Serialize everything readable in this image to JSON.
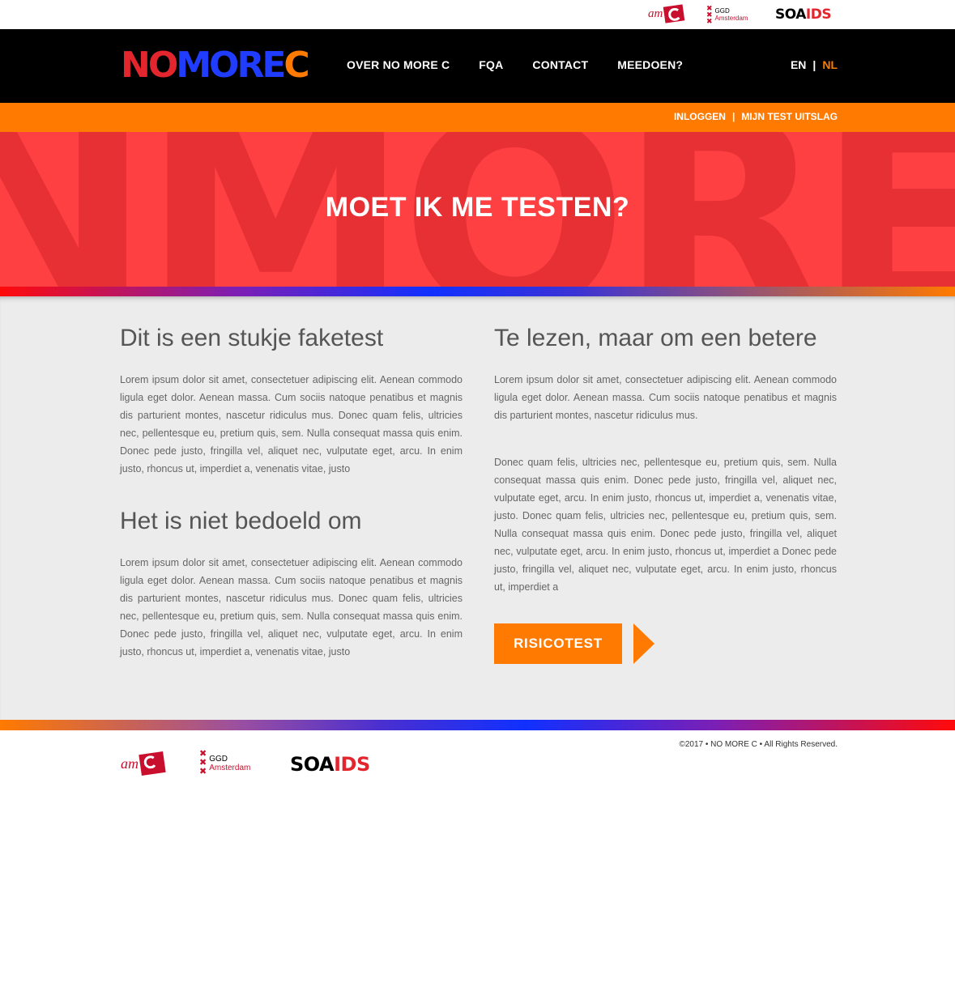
{
  "partners": {
    "amc_text": "am",
    "ggd_line1": "GGD",
    "ggd_line2": "Amsterdam",
    "soa": "SOA",
    "aids": "IDS",
    "soa_prefix_a": "A"
  },
  "header": {
    "brand_letters": [
      {
        "char": "N",
        "color": "#e3262e"
      },
      {
        "char": "O",
        "color": "#e3262e"
      },
      {
        "char": "M",
        "color": "#1f3cff"
      },
      {
        "char": "O",
        "color": "#1f3cff"
      },
      {
        "char": "R",
        "color": "#1f3cff"
      },
      {
        "char": "E",
        "color": "#1f3cff"
      },
      {
        "char": "C",
        "color": "#ff7a00"
      }
    ],
    "nav": [
      {
        "label": "OVER NO MORE C"
      },
      {
        "label": "FQA"
      },
      {
        "label": "CONTACT"
      },
      {
        "label": "MEEDOEN?"
      }
    ],
    "lang_en": "EN",
    "lang_sep": "|",
    "lang_nl": "NL"
  },
  "subbar": {
    "login": "INLOGGEN",
    "sep": "|",
    "results": "MIJN TEST UITSLAG"
  },
  "hero": {
    "bg_letters": "NMORE",
    "title": "MOET IK ME TESTEN?"
  },
  "content": {
    "left": {
      "heading1": "Dit is een stukje faketest",
      "para1": "Lorem ipsum dolor sit amet, consectetuer adipiscing elit. Aenean commodo ligula eget dolor. Aenean massa. Cum sociis natoque penatibus et magnis dis parturient montes, nascetur ridiculus mus. Donec quam felis, ultricies nec, pellentesque eu, pretium quis, sem. Nulla consequat massa quis enim. Donec pede justo, fringilla vel, aliquet nec, vulputate eget, arcu. In enim justo, rhoncus ut, imperdiet a, venenatis vitae, justo",
      "heading2": "Het is niet bedoeld om",
      "para2": "Lorem ipsum dolor sit amet, consectetuer adipiscing elit. Aenean commodo ligula eget dolor. Aenean massa. Cum sociis natoque penatibus et magnis dis parturient montes, nascetur ridiculus mus. Donec quam felis, ultricies nec, pellentesque eu, pretium quis, sem. Nulla consequat massa quis enim. Donec pede justo, fringilla vel, aliquet nec, vulputate eget, arcu. In enim justo, rhoncus ut, imperdiet a, venenatis vitae, justo"
    },
    "right": {
      "heading": "Te lezen, maar om een betere",
      "para1": "Lorem ipsum dolor sit amet, consectetuer adipiscing elit. Aenean commodo ligula eget dolor. Aenean massa. Cum sociis natoque penatibus et magnis dis parturient montes, nascetur ridiculus mus.",
      "para2": "Donec quam felis, ultricies nec, pellentesque eu, pretium quis, sem. Nulla consequat massa quis enim. Donec pede justo, fringilla vel, aliquet nec, vulputate eget, arcu. In enim justo, rhoncus ut, imperdiet a, venenatis vitae, justo. Donec quam felis, ultricies nec, pellentesque eu, pretium quis, sem. Nulla consequat massa quis enim. Donec pede justo, fringilla vel, aliquet nec, vulputate eget, arcu. In enim justo, rhoncus ut, imperdiet a Donec pede justo, fringilla vel, aliquet nec, vulputate eget, arcu. In enim justo, rhoncus ut, imperdiet a",
      "cta_label": "RISICOTEST"
    }
  },
  "footer": {
    "copyright": "©2017 • NO MORE C  • All Rights Reserved."
  },
  "colors": {
    "orange": "#ff7a00",
    "red": "#ff4043",
    "black": "#000000"
  }
}
